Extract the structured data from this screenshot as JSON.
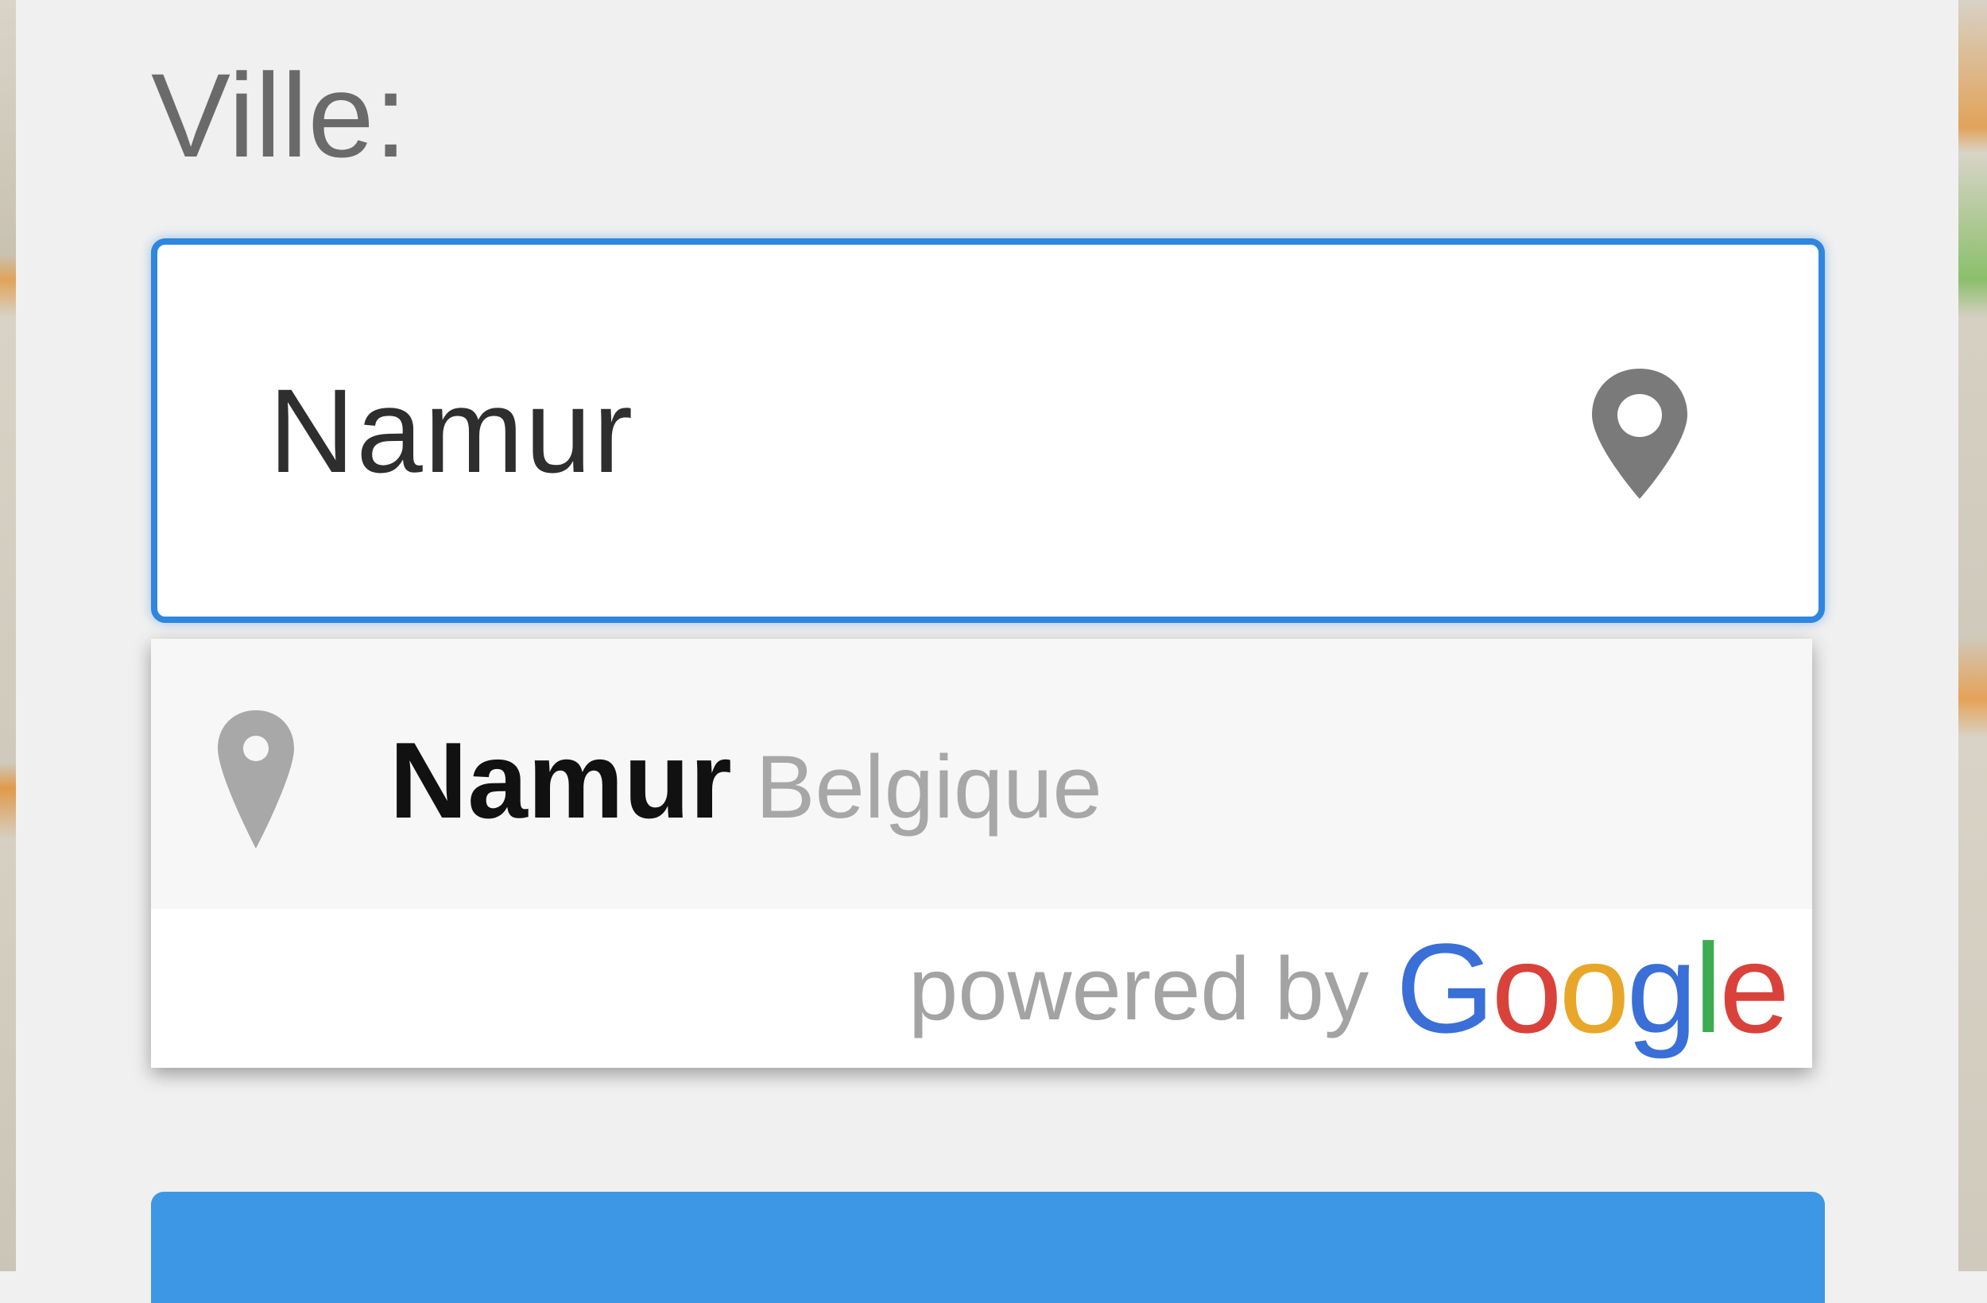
{
  "form": {
    "city_label": "Ville:",
    "city_value": "Namur"
  },
  "icons": {
    "input_icon": "map-pin-icon",
    "suggestion_icon": "map-pin-icon"
  },
  "autocomplete": {
    "suggestions": [
      {
        "main_text": "Namur",
        "secondary_text": "Belgique"
      }
    ],
    "attribution_text": "powered by",
    "attribution_logo": "Google"
  },
  "colors": {
    "input_focus_border": "#2f86de",
    "submit_button": "#3d97e4",
    "google_blue": "#3a6fd8",
    "google_red": "#d9423a",
    "google_yellow": "#e8a72a",
    "google_green": "#3cab52"
  }
}
